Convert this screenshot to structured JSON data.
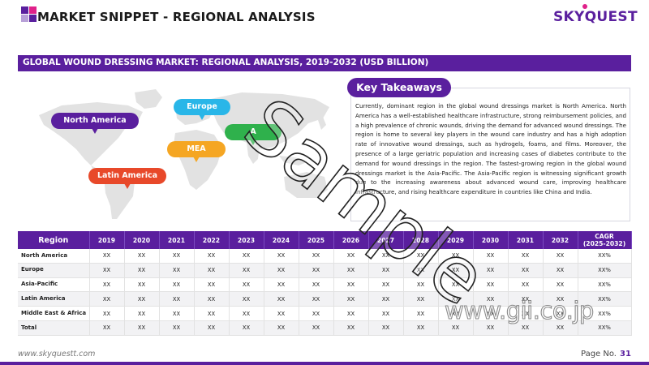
{
  "header": {
    "title": "MARKET SNIPPET - REGIONAL ANALYSIS",
    "logo_text": "SKYQUEST"
  },
  "banner": {
    "text": "GLOBAL WOUND DRESSING MARKET: REGIONAL ANALYSIS, 2019-2032 (USD BILLION)"
  },
  "map": {
    "labels": [
      {
        "name": "North America",
        "color": "#5a1f9e"
      },
      {
        "name": "Europe",
        "color": "#29b6e8"
      },
      {
        "name": "Asia-Pacific",
        "color": "#2fb14c"
      },
      {
        "name": "MEA",
        "color": "#f5a623"
      },
      {
        "name": "Latin America",
        "color": "#e8492a"
      }
    ],
    "label_texts": {
      "north_america": "North America",
      "europe": "Europe",
      "asia": "A",
      "mea": "MEA",
      "latin_america": "Latin America"
    }
  },
  "key_takeaways": {
    "title": "Key Takeaways",
    "text": "Currently, dominant region in the global wound dressings market is North America. North America has a well-established healthcare infrastructure, strong reimbursement policies, and a high prevalence of chronic wounds, driving the demand for advanced wound dressings. The region is home to several key players in the wound care industry and has a high adoption rate of innovative wound dressings, such as hydrogels, foams, and films. Moreover, the presence of a large geriatric population and increasing cases of diabetes contribute to the demand for wound dressings in the region. The fastest-growing region in the global wound dressings market is the Asia-Pacific. The Asia-Pacific region is witnessing significant growth due to the increasing awareness about advanced wound care, improving healthcare infrastructure, and rising healthcare expenditure in countries like China and India."
  },
  "table": {
    "headers": [
      "Region",
      "2019",
      "2020",
      "2021",
      "2022",
      "2023",
      "2024",
      "2025",
      "2026",
      "2027",
      "2028",
      "2029",
      "2030",
      "2031",
      "2032",
      "CAGR\n(2025-2032)"
    ],
    "rows": [
      {
        "region": "North America",
        "cells": [
          "XX",
          "XX",
          "XX",
          "XX",
          "XX",
          "XX",
          "XX",
          "XX",
          "XX",
          "XX",
          "XX",
          "XX",
          "XX",
          "XX",
          "XX%"
        ]
      },
      {
        "region": "Europe",
        "cells": [
          "XX",
          "XX",
          "XX",
          "XX",
          "XX",
          "XX",
          "XX",
          "XX",
          "XX",
          "XX",
          "XX",
          "XX",
          "XX",
          "XX",
          "XX%"
        ]
      },
      {
        "region": "Asia-Pacific",
        "cells": [
          "XX",
          "XX",
          "XX",
          "XX",
          "XX",
          "XX",
          "XX",
          "XX",
          "XX",
          "XX",
          "XX",
          "XX",
          "XX",
          "XX",
          "XX%"
        ]
      },
      {
        "region": "Latin America",
        "cells": [
          "XX",
          "XX",
          "XX",
          "XX",
          "XX",
          "XX",
          "XX",
          "XX",
          "XX",
          "XX",
          "XX",
          "XX",
          "XX",
          "XX",
          "XX%"
        ]
      },
      {
        "region": "Middle East & Africa",
        "cells": [
          "XX",
          "XX",
          "XX",
          "XX",
          "XX",
          "XX",
          "XX",
          "XX",
          "XX",
          "XX",
          "XX",
          "XX",
          "XX",
          "XX",
          "XX%"
        ]
      },
      {
        "region": "Total",
        "cells": [
          "XX",
          "XX",
          "XX",
          "XX",
          "XX",
          "XX",
          "XX",
          "XX",
          "XX",
          "XX",
          "XX",
          "XX",
          "XX",
          "XX",
          "XX%"
        ]
      }
    ]
  },
  "footer": {
    "website": "www.skyquestt.com",
    "page_label": "Page No.",
    "page_number": "31"
  },
  "watermarks": {
    "sample": "Sample",
    "gii": "www.gii.co.jp"
  },
  "colors": {
    "brand_purple": "#5a1f9e",
    "accent_pink": "#e0218a"
  }
}
